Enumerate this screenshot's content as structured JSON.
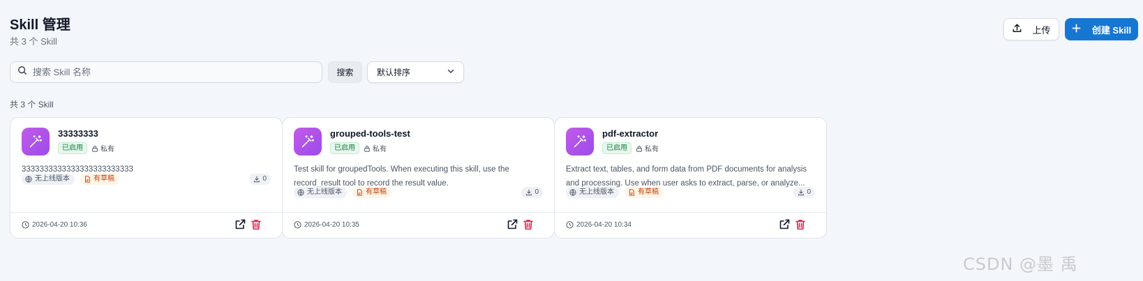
{
  "header": {
    "title": "Skill 管理",
    "subtitle": "共 3 个 Skill",
    "upload_label": "上传",
    "create_label": "创建 Skill"
  },
  "toolbar": {
    "search_placeholder": "搜索 Skill 名称",
    "search_button": "搜索",
    "sort_selected": "默认排序"
  },
  "list_count": "共 3 个 Skill",
  "skills": [
    {
      "name": "33333333",
      "status": "已启用",
      "visibility": "私有",
      "description": "3333333333333333333333333",
      "version_tag": "无上线版本",
      "draft_tag": "有草稿",
      "downloads": "0",
      "updated": "2026-04-20 10:36"
    },
    {
      "name": "grouped-tools-test",
      "status": "已启用",
      "visibility": "私有",
      "description": "Test skill for groupedTools. When executing this skill, use the record_result tool to record the result value.",
      "version_tag": "无上线版本",
      "draft_tag": "有草稿",
      "downloads": "0",
      "updated": "2026-04-20 10:35"
    },
    {
      "name": "pdf-extractor",
      "status": "已启用",
      "visibility": "私有",
      "description": "Extract text, tables, and form data from PDF documents for analysis and processing. Use when user asks to extract, parse, or analyze...",
      "version_tag": "无上线版本",
      "draft_tag": "有草稿",
      "downloads": "0",
      "updated": "2026-04-20 10:34"
    }
  ],
  "watermark": "CSDN @墨 禹",
  "colors": {
    "primary": "#1677d2",
    "icon_gradient_start": "#c35be8",
    "icon_gradient_end": "#9b4bea",
    "enabled_green": "#15803d",
    "draft_orange": "#c2410c",
    "delete_red": "#e11d48"
  }
}
